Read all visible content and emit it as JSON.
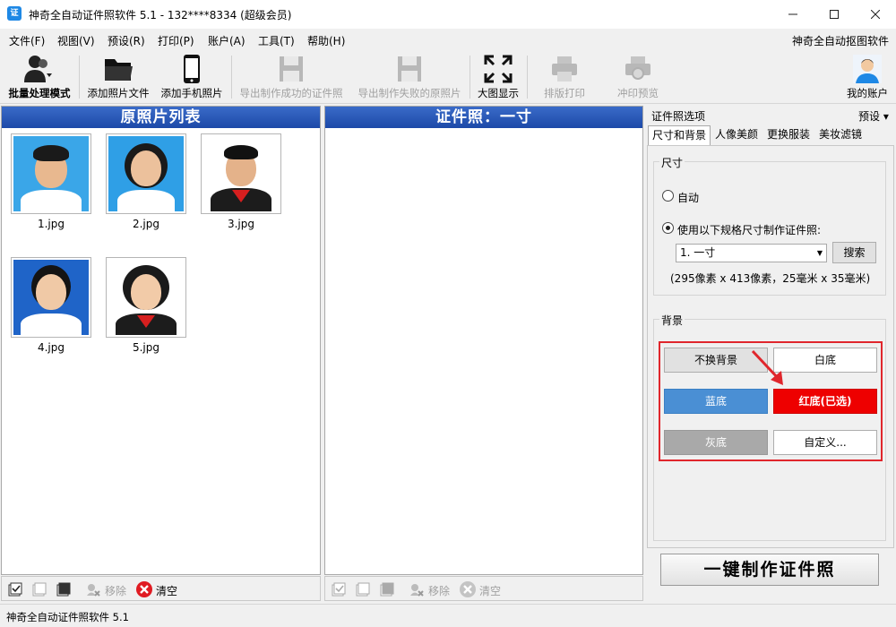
{
  "window": {
    "title": "神奇全自动证件照软件 5.1 - 132****8334 (超级会员)",
    "app_icon_glyph": "证"
  },
  "menu": {
    "items": [
      "文件(F)",
      "视图(V)",
      "预设(R)",
      "打印(P)",
      "账户(A)",
      "工具(T)",
      "帮助(H)"
    ],
    "right_link": "神奇全自动抠图软件"
  },
  "toolbar": {
    "batch_mode": "批量处理模式",
    "add_photo_file": "添加照片文件",
    "add_phone_photo": "添加手机照片",
    "export_success": "导出制作成功的证件照",
    "export_failed": "导出制作失败的原照片",
    "large_view": "大图显示",
    "layout_print": "排版打印",
    "print_preview": "冲印预览",
    "my_account": "我的账户"
  },
  "originals": {
    "header": "原照片列表",
    "photos": [
      {
        "name": "1.jpg",
        "bg": "#3aa6e8"
      },
      {
        "name": "2.jpg",
        "bg": "#2f9fe6"
      },
      {
        "name": "3.jpg",
        "bg": "#ffffff"
      },
      {
        "name": "4.jpg",
        "bg": "#1f64c8"
      },
      {
        "name": "5.jpg",
        "bg": "#ffffff"
      }
    ]
  },
  "idphoto": {
    "header": "证件照：一寸"
  },
  "bottom_left": {
    "remove": "移除",
    "clear": "清空"
  },
  "bottom_mid": {
    "remove": "移除",
    "clear": "清空"
  },
  "options": {
    "title": "证件照选项",
    "preset": "预设",
    "tabs": [
      "尺寸和背景",
      "人像美颜",
      "更换服装",
      "美妆滤镜"
    ],
    "size_group": "尺寸",
    "auto": "自动",
    "use_spec": "使用以下规格尺寸制作证件照:",
    "spec_value": "1. 一寸",
    "search": "搜索",
    "size_info": "(295像素 x 413像素，25毫米 x 35毫米)",
    "bg_group": "背景",
    "bg_options": {
      "no_change": "不换背景",
      "white": "白底",
      "blue": "蓝底",
      "red": "红底(已选)",
      "gray": "灰底",
      "custom": "自定义..."
    },
    "make_button": "一键制作证件照"
  },
  "status": {
    "text": "神奇全自动证件照软件 5.1"
  },
  "colors": {
    "header_blue": "#1c49a8",
    "bg_blue": "#4a8fd4",
    "bg_red": "#ee0000",
    "bg_gray": "#a9a9a9",
    "highlight_red": "#e0262c"
  }
}
